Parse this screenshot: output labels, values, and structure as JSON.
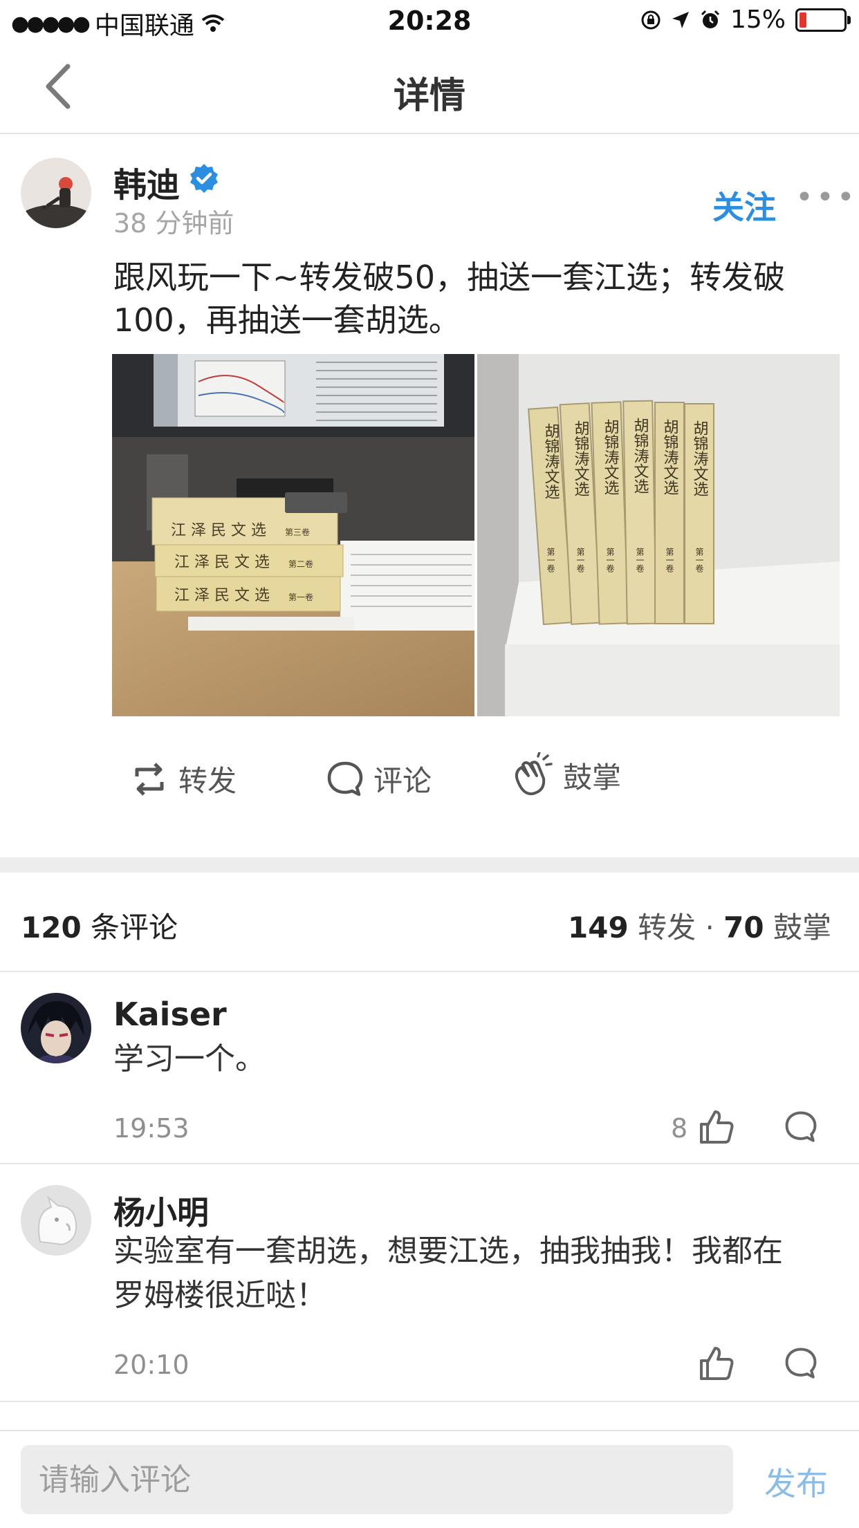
{
  "status_bar": {
    "carrier": "中国联通",
    "time": "20:28",
    "battery": "15%",
    "battery_level": 0.15
  },
  "nav": {
    "title": "详情"
  },
  "post": {
    "author": "韩迪",
    "time_ago": "38 分钟前",
    "follow_label": "关注",
    "text_line1": "跟风玩一下~转发破50，抽送一套江选；转发破",
    "text_line2": "100，再抽送一套胡选。",
    "actions": {
      "repost": "转发",
      "comment": "评论",
      "clap": "鼓掌"
    },
    "image1_spines": [
      "江 泽 民 文 选",
      "江 泽 民 文 选",
      "江 泽 民 文 选"
    ],
    "image1_spine_tags": [
      "第三卷",
      "第二卷",
      "第一卷"
    ],
    "image2_spines": [
      "胡锦涛文选",
      "胡锦涛文选",
      "胡锦涛文选",
      "胡锦涛文选",
      "胡锦涛文选",
      "胡锦涛文选"
    ],
    "image2_spine_tag": "第一卷"
  },
  "stats": {
    "comments_count": "120",
    "comments_label": "条评论",
    "reposts_count": "149",
    "reposts_label": "转发",
    "dot": "·",
    "claps_count": "70",
    "claps_label": "鼓掌"
  },
  "comments": [
    {
      "name": "Kaiser",
      "text_line1": "学习一个。",
      "text_line2": "",
      "time": "19:53",
      "likes": "8"
    },
    {
      "name": "杨小明",
      "text_line1": "实验室有一套胡选，想要江选，抽我抽我！我都在",
      "text_line2": "罗姆楼很近哒！",
      "time": "20:10",
      "likes": ""
    }
  ],
  "input": {
    "placeholder": "请输入评论",
    "publish_label": "发布"
  },
  "colors": {
    "accent": "#2b8ee0",
    "verified": "#2b8ee0",
    "battery_low": "#e0362c"
  }
}
